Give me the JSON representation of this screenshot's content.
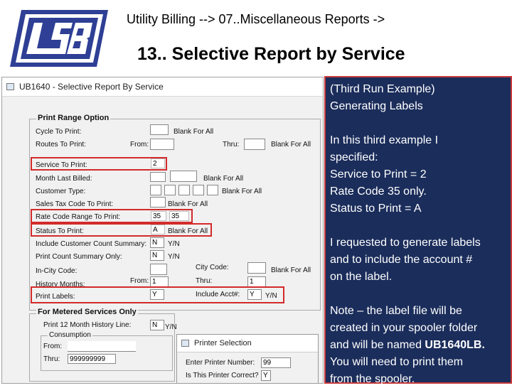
{
  "header": {
    "breadcrumb": "Utility Billing -->   07..Miscellaneous Reports ->",
    "title": "13.. Selective Report by Service"
  },
  "window": {
    "title": "UB1640 - Selective Report By Service",
    "print_range_title": "Print Range Option",
    "metered_title": "For Metered Services Only",
    "consumption_title": "Consumption",
    "rows": {
      "cycle": {
        "label": "Cycle To Print:",
        "note": "Blank For All",
        "value": ""
      },
      "routes": {
        "label": "Routes To Print:",
        "from_label": "From:",
        "from_value": "",
        "thru_label": "Thru:",
        "thru_value": "",
        "note": "Blank For All"
      },
      "service": {
        "label": "Service To Print:",
        "value": "2"
      },
      "month_billed": {
        "label": "Month Last Billed:",
        "note": "Blank For All",
        "value": ""
      },
      "customer_type": {
        "label": "Customer Type:",
        "note": "Blank For All"
      },
      "sales_tax": {
        "label": "Sales Tax Code To Print:",
        "note": "Blank For All"
      },
      "rate_code": {
        "label": "Rate Code Range To Print:",
        "from_value": "35",
        "thru_value": "35"
      },
      "status": {
        "label": "Status To Print:",
        "value": "A",
        "note": "Blank For All"
      },
      "include_count": {
        "label": "Include Customer Count Summary:",
        "value": "N",
        "note": "Y/N"
      },
      "count_only": {
        "label": "Print Count Summary Only:",
        "value": "N",
        "note": "Y/N"
      },
      "in_city": {
        "label": "In-City Code:",
        "city_label": "City Code:",
        "note": "Blank For All"
      },
      "history": {
        "label": "History Months:",
        "from_label": "From:",
        "from_value": "1",
        "thru_label": "Thru:",
        "thru_value": "1"
      },
      "print_labels": {
        "label": "Print Labels:",
        "value": "Y",
        "acct_label": "Include Acct#:",
        "acct_value": "Y",
        "note": "Y/N"
      },
      "history12": {
        "label": "Print 12 Month History Line:",
        "value": "N",
        "note": "Y/N"
      },
      "cons_from": {
        "label": "From:",
        "value": ""
      },
      "cons_thru": {
        "label": "Thru:",
        "value": "999999999"
      }
    }
  },
  "printer_dialog": {
    "title": "Printer Selection",
    "number_label": "Enter Printer Number:",
    "number_value": "99",
    "correct_label": "Is This Printer Correct?",
    "correct_value": "Y"
  },
  "panel": {
    "heading1": "(Third Run Example)",
    "heading2": "Generating Labels",
    "lines": [
      "In this third example I",
      "specified:",
      "Service to Print = 2",
      "Rate Code 35 only.",
      "Status to Print = A"
    ],
    "para2": [
      "I requested to generate labels",
      "and to include the account #",
      "on the label."
    ],
    "para3_pre": [
      "Note – the label file will be",
      "created in your spooler folder"
    ],
    "para3_name_prefix": "and will be named ",
    "para3_filename": "UB1640LB.",
    "para3_post": [
      "You will need to print them",
      "from the spooler."
    ]
  },
  "colors": {
    "panel_bg": "#1b2d5b",
    "highlight": "#d42a2a",
    "logo": "#2e3f95"
  }
}
